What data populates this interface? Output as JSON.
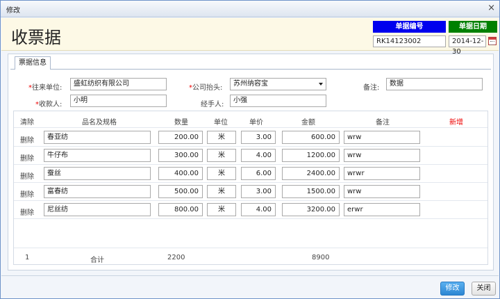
{
  "window": {
    "title": "修改",
    "close_glyph": "×"
  },
  "header": {
    "title": "收票据",
    "doc_no_label": "单据编号",
    "doc_no_value": "RK14123002",
    "doc_date_label": "单据日期",
    "doc_date_value": "2014-12-30",
    "accent_colors": {
      "doc_no_bg": "#0000ee",
      "doc_date_bg": "#008000",
      "header_bg": "#fdf9e6"
    }
  },
  "tab": {
    "label": "票据信息"
  },
  "form": {
    "required_mark": "*",
    "partner_label": "往来单位:",
    "partner_value": "盛虹纺织有限公司",
    "company_label": "公司抬头:",
    "company_value": "苏州纳容宝",
    "remark_label": "备注:",
    "remark_value": "数据",
    "payee_label": "收款人:",
    "payee_value": "小明",
    "handler_label": "经手人:",
    "handler_value": "小强"
  },
  "grid": {
    "headers": {
      "clear": "清除",
      "item": "品名及规格",
      "qty": "数量",
      "unit": "单位",
      "price": "单价",
      "amount": "金额",
      "note": "备注",
      "add": "新增"
    },
    "delete_label": "删除",
    "rows": [
      {
        "item": "春亚纺",
        "qty": "200.00",
        "unit": "米",
        "price": "3.00",
        "amount": "600.00",
        "note": "wrw"
      },
      {
        "item": "牛仔布",
        "qty": "300.00",
        "unit": "米",
        "price": "4.00",
        "amount": "1200.00",
        "note": "wrw"
      },
      {
        "item": "蚕丝",
        "qty": "400.00",
        "unit": "米",
        "price": "6.00",
        "amount": "2400.00",
        "note": "wrwr"
      },
      {
        "item": "富春纺",
        "qty": "500.00",
        "unit": "米",
        "price": "3.00",
        "amount": "1500.00",
        "note": "wrw"
      },
      {
        "item": "尼丝纺",
        "qty": "800.00",
        "unit": "米",
        "price": "4.00",
        "amount": "3200.00",
        "note": "erwr"
      }
    ],
    "footer": {
      "index": "1",
      "label": "合计",
      "qty_total": "2200",
      "amount_total": "8900"
    }
  },
  "buttons": {
    "submit": "修改",
    "close": "关闭"
  }
}
